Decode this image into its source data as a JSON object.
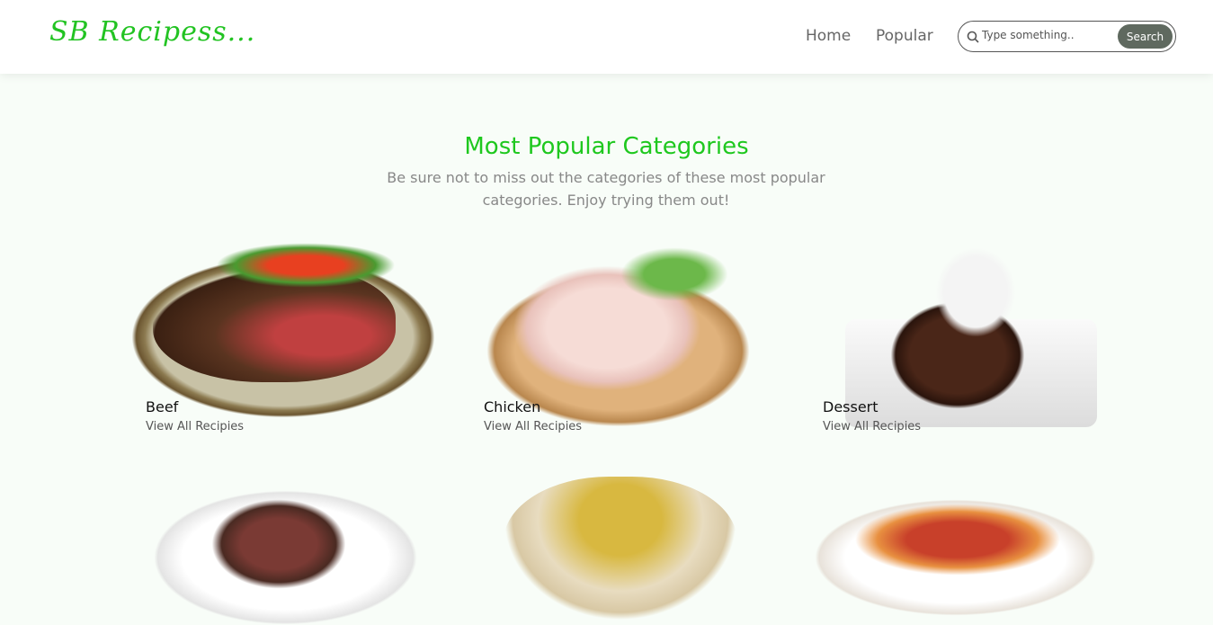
{
  "header": {
    "logo": "SB Recipess...",
    "nav": [
      "Home",
      "Popular"
    ],
    "search": {
      "placeholder": "Type something..",
      "button": "Search"
    }
  },
  "main": {
    "title": "Most Popular Categories",
    "subtitle": "Be sure not to miss out the categories of these most popular categories. Enjoy trying them out!",
    "categories": [
      {
        "name": "Beef",
        "link": "View All Recipies"
      },
      {
        "name": "Chicken",
        "link": "View All Recipies"
      },
      {
        "name": "Dessert",
        "link": "View All Recipies"
      }
    ]
  },
  "colors": {
    "accent": "#1fc81f",
    "button": "#5f695f"
  }
}
